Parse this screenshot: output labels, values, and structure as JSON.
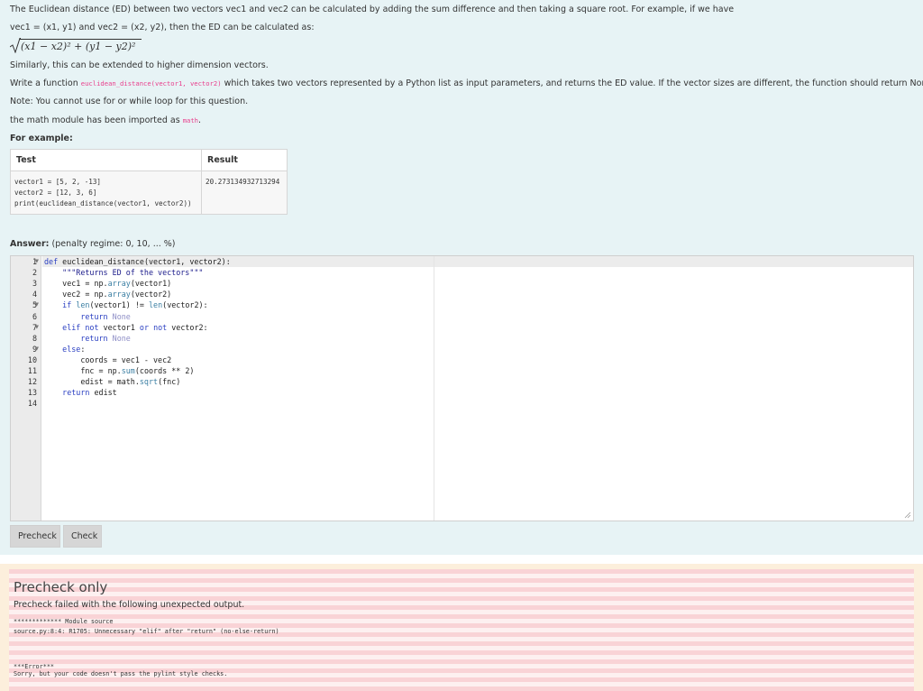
{
  "question": {
    "intro_line1": "The Euclidean distance (ED) between two vectors vec1 and vec2 can be calculated by adding the sum difference and then taking a square root. For example, if we have",
    "intro_line2": "vec1 = (x1, y1) and vec2 = (x2, y2), then the ED can be calculated as:",
    "formula": "(x1 − x2)² + (y1 − y2)²",
    "similarly": "Similarly, this can be extended to higher dimension vectors.",
    "write_prefix": "Write a function ",
    "function_signature": "euclidean_distance(vector1, vector2)",
    "write_suffix": " which takes two vectors represented by a Python list as input parameters, and returns the ED value. If the vector sizes are different, the function should return None.",
    "note": "Note: You cannot use for or while loop for this question.",
    "math_prefix": "the math module has been imported as ",
    "math_module": "math",
    "math_suffix": ".",
    "for_example": "For example:"
  },
  "example_table": {
    "headers": [
      "Test",
      "Result"
    ],
    "test_lines": [
      "vector1 = [5, 2, -13]",
      "vector2 = [12, 3, 6]",
      "print(euclidean_distance(vector1, vector2))"
    ],
    "result": "20.273134932713294"
  },
  "answer": {
    "label": "Answer:",
    "penalty": "(penalty regime: 0, 10, ... %)"
  },
  "editor": {
    "line_numbers": [
      "1",
      "2",
      "3",
      "4",
      "5",
      "6",
      "7",
      "8",
      "9",
      "10",
      "11",
      "12",
      "13",
      "14"
    ],
    "fold_lines": [
      1,
      5,
      7,
      9
    ],
    "code": [
      "def euclidean_distance(vector1, vector2):",
      "    \"\"\"Returns ED of the vectors\"\"\"",
      "    vec1 = np.array(vector1)",
      "    vec2 = np.array(vector2)",
      "    if len(vector1) != len(vector2):",
      "        return None",
      "    elif not vector1 or not vector2:",
      "        return None",
      "    else:",
      "        coords = vec1 - vec2",
      "        fnc = np.sum(coords ** 2)",
      "        edist = math.sqrt(fnc)",
      "    return edist",
      ""
    ]
  },
  "buttons": {
    "precheck": "Precheck",
    "check": "Check"
  },
  "feedback": {
    "title": "Precheck only",
    "message": "Precheck failed with the following unexpected output.",
    "output_line1": "************* Module source",
    "output_line2": "source.py:8:4: R1705: Unnecessary \"elif\" after \"return\" (no-else-return)",
    "error_header": "***Error***",
    "error_message": "Sorry, but your code doesn't pass the pylint style checks."
  }
}
